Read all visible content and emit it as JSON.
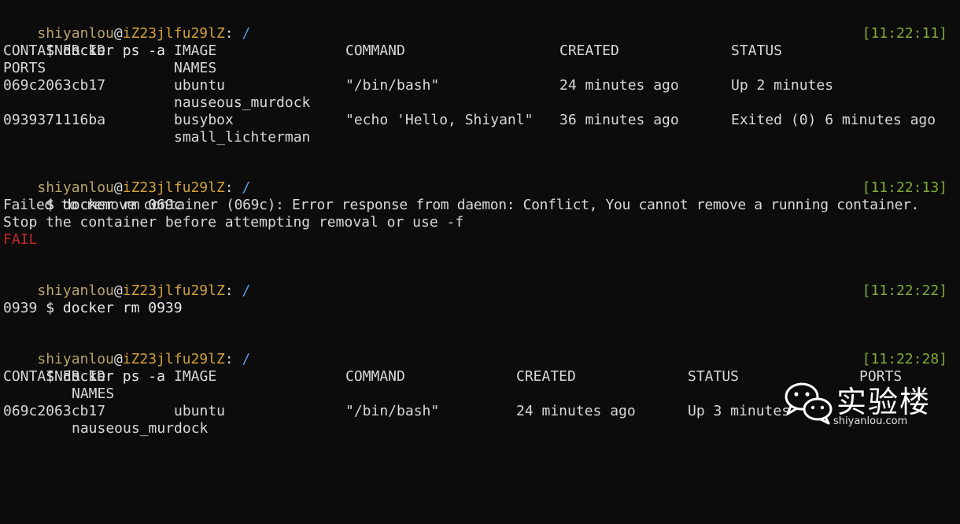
{
  "prompt": {
    "user": "shiyanlou",
    "at": "@",
    "host": "iZ23jlfu29lZ",
    "colon": ":",
    "path": " /"
  },
  "block1": {
    "command": " $ docker ps -a",
    "time": "[11:22:11]",
    "headers": [
      "CONTAINER ID",
      "IMAGE",
      "COMMAND",
      "CREATED",
      "STATUS"
    ],
    "headers_wrap": [
      "PORTS",
      "NAMES"
    ],
    "rows": [
      {
        "id": "069c2063cb17",
        "image": "ubuntu",
        "command": "\"/bin/bash\"",
        "created": "24 minutes ago",
        "status": "Up 2 minutes",
        "name": "nauseous_murdock"
      },
      {
        "id": "0939371116ba",
        "image": "busybox",
        "command": "\"echo 'Hello, Shiyanl\"",
        "created": "36 minutes ago",
        "status": "Exited (0) 6 minutes ago",
        "name": "small_lichterman"
      }
    ]
  },
  "block2": {
    "command": " $ docker rm 069c",
    "time": "[11:22:13]",
    "error_line1": "Failed to remove container (069c): Error response from daemon: Conflict, You cannot remove a running container.",
    "error_line2": "Stop the container before attempting removal or use -f",
    "fail": "FAIL"
  },
  "block3": {
    "command": " $ docker rm 0939",
    "time": "[11:22:22]",
    "output": "0939"
  },
  "block4": {
    "command": " $ docker ps -a",
    "time": "[11:22:28]",
    "headers": [
      "CONTAINER ID",
      "IMAGE",
      "COMMAND",
      "CREATED",
      "STATUS",
      "PORTS"
    ],
    "headers_wrap": "NAMES",
    "row": {
      "id": "069c2063cb17",
      "image": "ubuntu",
      "command": "\"/bin/bash\"",
      "created": "24 minutes ago",
      "status": "Up 3 minutes",
      "name": "nauseous_murdock"
    }
  },
  "watermark": {
    "icon": "wechat-icon",
    "title": "实验楼",
    "url": "shiyanlou.com"
  }
}
